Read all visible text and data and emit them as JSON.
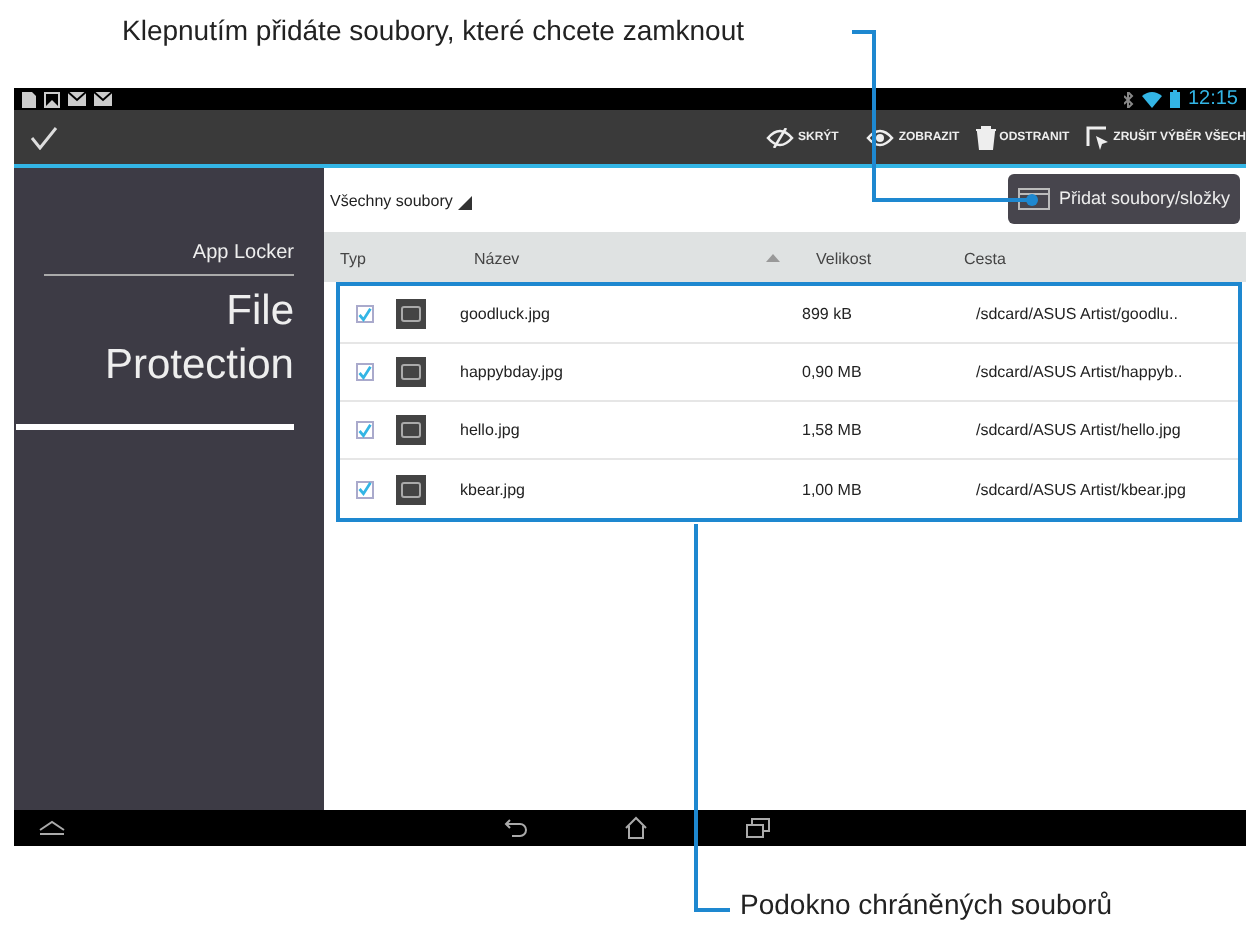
{
  "callouts": [
    {
      "text": "Klepnutím přidáte soubory, které chcete zamknout"
    },
    {
      "text": "Podokno chráněných souborů"
    }
  ],
  "status_bar": {
    "time": "12:15"
  },
  "action_bar": {
    "actions": [
      {
        "kind": "hide",
        "label": "SKRÝT"
      },
      {
        "kind": "show",
        "label": "ZOBRAZIT"
      },
      {
        "kind": "delete",
        "label": "ODSTRANIT"
      },
      {
        "kind": "deselect",
        "label": "ZRUŠIT VÝBĚR VŠECH"
      }
    ]
  },
  "sidebar": {
    "app": "App Locker",
    "title": "File Protection"
  },
  "filter": {
    "label": "Všechny soubory"
  },
  "add_button": {
    "label": "Přidat soubory/složky"
  },
  "table": {
    "columns": [
      "Typ",
      "Název",
      "Velikost",
      "Cesta"
    ],
    "rows": [
      {
        "checked": true,
        "name": "goodluck.jpg",
        "size": "899 kB",
        "path": "/sdcard/ASUS Artist/goodlu.."
      },
      {
        "checked": true,
        "name": "happybday.jpg",
        "size": "0,90 MB",
        "path": "/sdcard/ASUS Artist/happyb.."
      },
      {
        "checked": true,
        "name": "hello.jpg",
        "size": "1,58 MB",
        "path": "/sdcard/ASUS Artist/hello.jpg"
      },
      {
        "checked": true,
        "name": "kbear.jpg",
        "size": "1,00 MB",
        "path": "/sdcard/ASUS Artist/kbear.jpg"
      }
    ]
  }
}
